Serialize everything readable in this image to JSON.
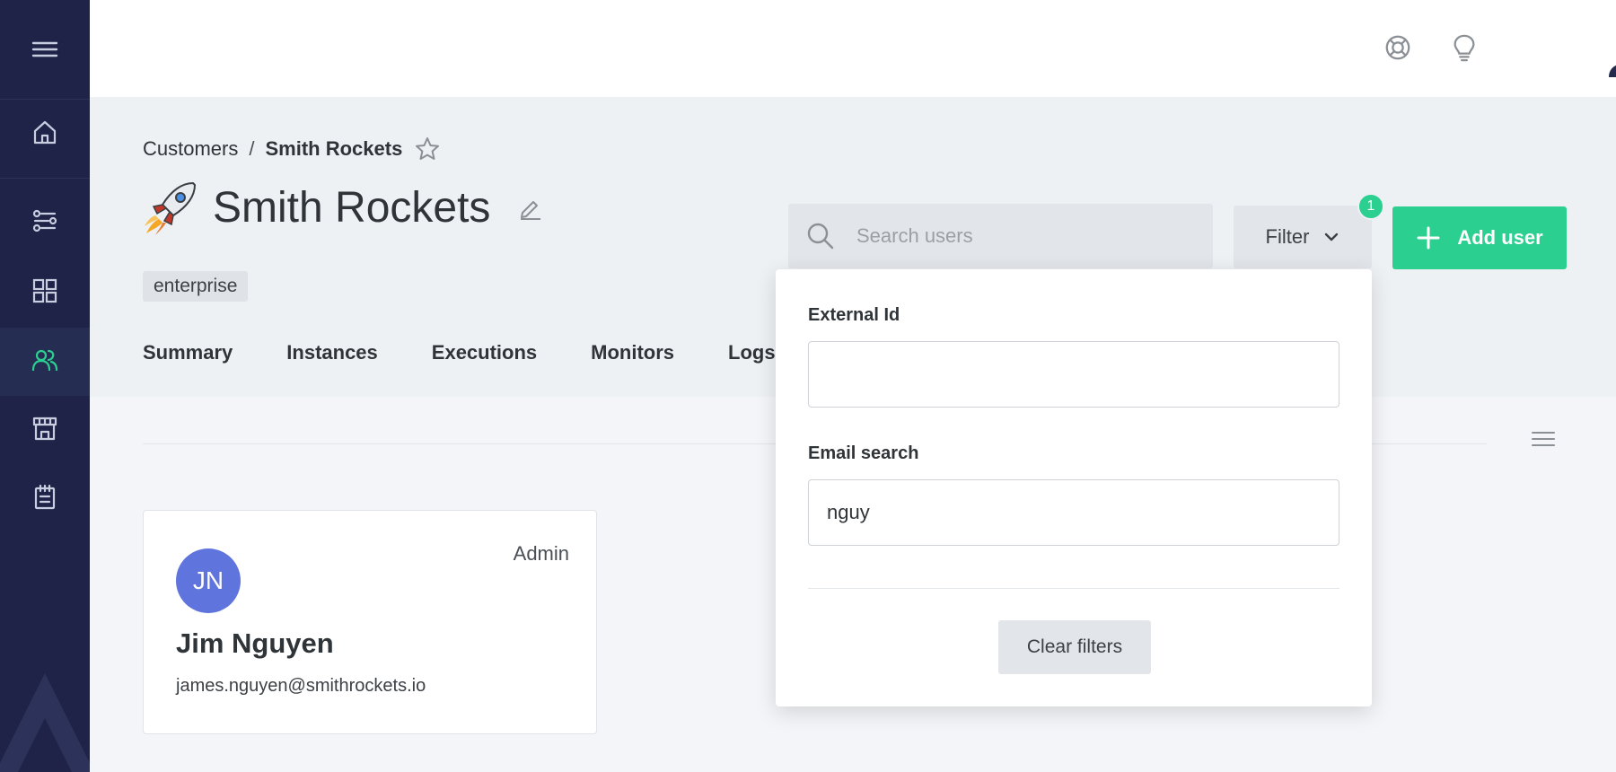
{
  "sidebar": {
    "menu_icon": "hamburger-icon",
    "items": [
      {
        "name": "home",
        "icon": "home-icon"
      },
      {
        "name": "flows",
        "icon": "flows-icon"
      },
      {
        "name": "dashboard",
        "icon": "grid-icon"
      },
      {
        "name": "customers",
        "icon": "users-icon",
        "active": true
      },
      {
        "name": "marketplace",
        "icon": "store-icon"
      },
      {
        "name": "logs",
        "icon": "notepad-icon"
      }
    ],
    "active_color": "#2bcf8f"
  },
  "topbar": {
    "support_icon": "lifebuoy-icon",
    "tips_icon": "lightbulb-icon",
    "avatar_icon": "user-avatar-icon"
  },
  "breadcrumb": {
    "parent": "Customers",
    "separator": "/",
    "current": "Smith Rockets"
  },
  "customer": {
    "name": "Smith Rockets",
    "tag": "enterprise"
  },
  "tabs": [
    "Summary",
    "Instances",
    "Executions",
    "Monitors",
    "Logs"
  ],
  "search": {
    "placeholder": "Search users",
    "value": ""
  },
  "filter": {
    "label": "Filter",
    "badge_count": "1",
    "fields": {
      "external_id_label": "External Id",
      "external_id_value": "",
      "email_label": "Email search",
      "email_value": "nguy"
    },
    "clear_label": "Clear filters"
  },
  "add_user": {
    "label": "Add user"
  },
  "users": [
    {
      "initials": "JN",
      "name": "Jim Nguyen",
      "email": "james.nguyen@smithrockets.io",
      "role": "Admin"
    }
  ],
  "colors": {
    "accent": "#2bcf8f",
    "sidebar": "#1e2347",
    "avatar": "#6074dd"
  }
}
